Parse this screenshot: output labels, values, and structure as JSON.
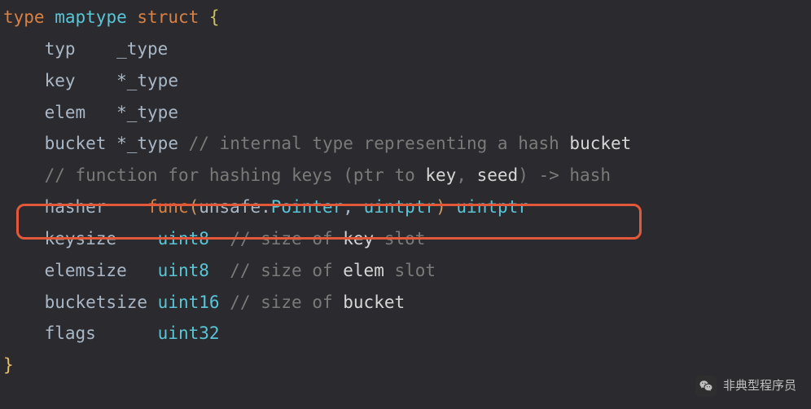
{
  "code": {
    "l1": {
      "kw_type": "type",
      "name": "maptype",
      "kw_struct": "struct",
      "brace": "{"
    },
    "l2": {
      "field": "typ",
      "type": "_type"
    },
    "l3": {
      "field": "key",
      "star": "*",
      "type": "_type"
    },
    "l4": {
      "field": "elem",
      "star": "*",
      "type": "_type"
    },
    "l5": {
      "field": "bucket",
      "star": "*",
      "type": "_type",
      "c_pre": "// internal type representing a hash ",
      "c_hi": "bucket"
    },
    "l6": {
      "c_pre": "// function for hashing keys (ptr to ",
      "c_hi1": "key",
      "c_mid": ", ",
      "c_hi2": "seed",
      "c_post": ") -> hash"
    },
    "l7": {
      "field": "hasher",
      "kw_func": "func",
      "p_open": "(",
      "pkg": "unsafe",
      "dot": ".",
      "ptr": "Pointer",
      "comma": ", ",
      "arg2": "uintptr",
      "p_close": ")",
      "ret": "uintptr"
    },
    "l8": {
      "field": "keysize",
      "type": "uint8",
      "c_pre": "// size of ",
      "c_hi": "key",
      "c_post": " slot"
    },
    "l9": {
      "field": "elemsize",
      "type": "uint8",
      "c_pre": "// size of ",
      "c_hi": "elem",
      "c_post": " slot"
    },
    "l10": {
      "field": "bucketsize",
      "type": "uint16",
      "c_pre": "// size of ",
      "c_hi": "bucket"
    },
    "l11": {
      "field": "flags",
      "type": "uint32"
    },
    "l12": {
      "brace": "}"
    }
  },
  "watermark": {
    "text": "非典型程序员"
  }
}
